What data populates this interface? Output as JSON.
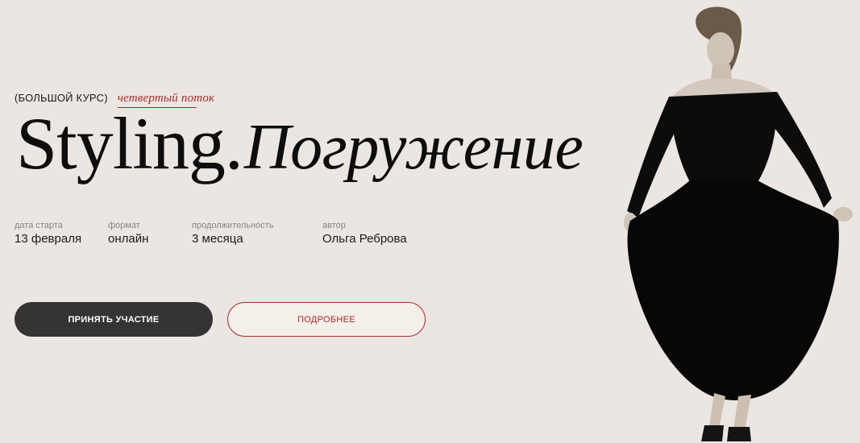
{
  "hero": {
    "course_type": "(БОЛЬШОЙ КУРС)",
    "stream": "четвертый поток",
    "title_word": "Styling.",
    "title_italic": "Погружение"
  },
  "facts": [
    {
      "label": "дата старта",
      "value": "13 февраля"
    },
    {
      "label": "формат",
      "value": "онлайн"
    },
    {
      "label": "продолжительность",
      "value": "3 месяца"
    },
    {
      "label": "автор",
      "value": "Ольга Реброва"
    }
  ],
  "buttons": {
    "join": "ПРИНЯТЬ УЧАСТИЕ",
    "more": "ПОДРОБНЕЕ"
  },
  "colors": {
    "background": "#ebe6e1",
    "accent": "#a52a2a",
    "primary_button": "#343434"
  }
}
